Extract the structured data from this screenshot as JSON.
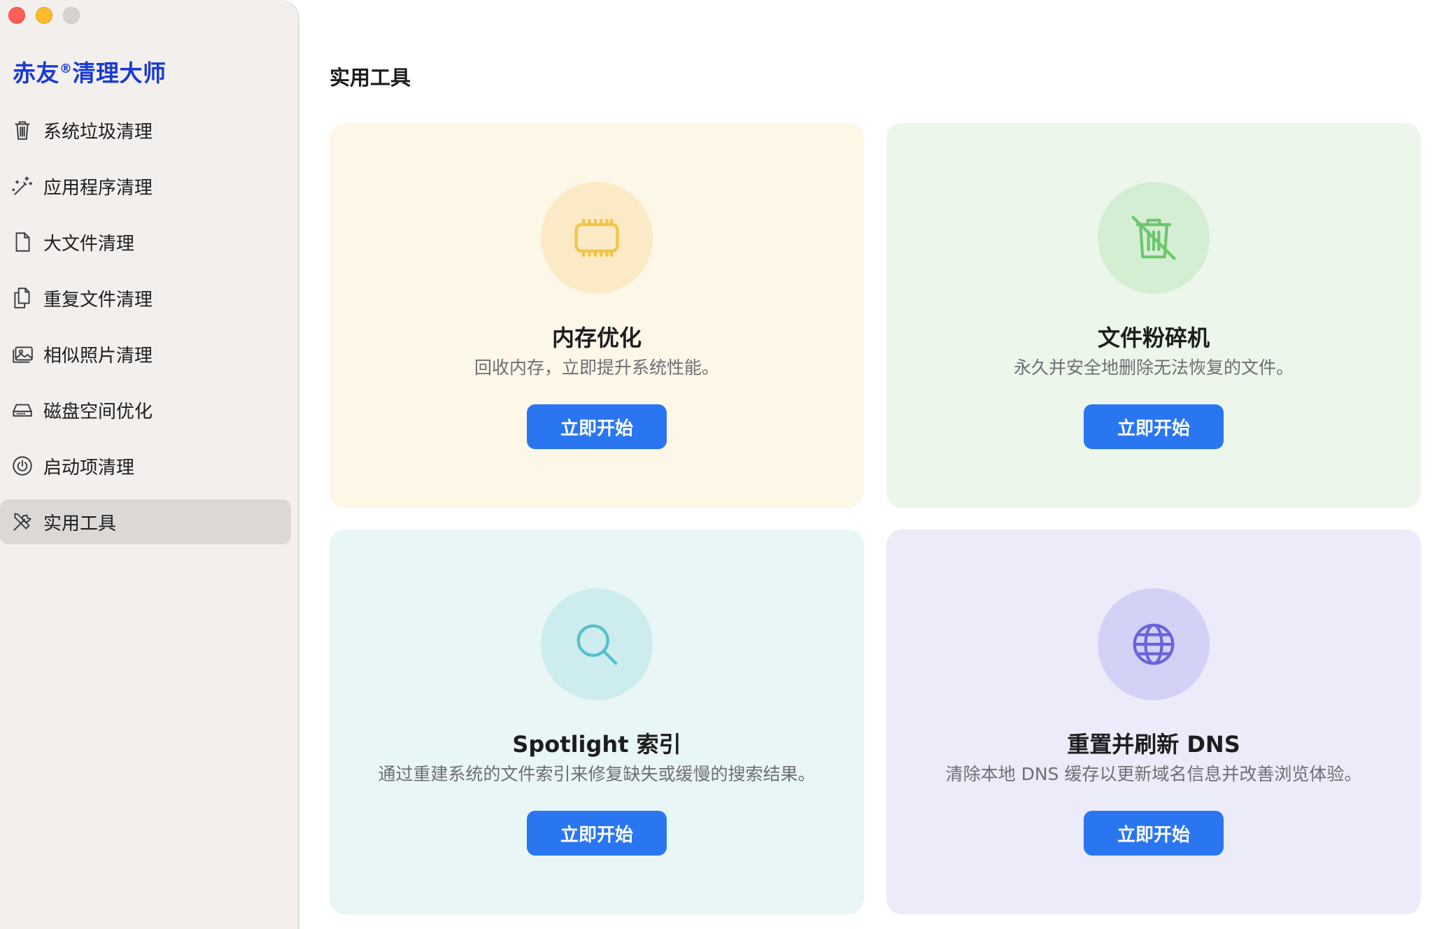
{
  "window": {
    "controls": [
      "close",
      "minimize",
      "zoom"
    ]
  },
  "sidebar": {
    "brand_prefix": "赤友",
    "brand_mark": "®",
    "brand_suffix": "清理大师",
    "items": [
      {
        "label": "系统垃圾清理",
        "icon": "trash-icon",
        "active": false
      },
      {
        "label": "应用程序清理",
        "icon": "magic-wand-icon",
        "active": false
      },
      {
        "label": "大文件清理",
        "icon": "document-icon",
        "active": false
      },
      {
        "label": "重复文件清理",
        "icon": "duplicate-documents-icon",
        "active": false
      },
      {
        "label": "相似照片清理",
        "icon": "photos-icon",
        "active": false
      },
      {
        "label": "磁盘空间优化",
        "icon": "disk-drive-icon",
        "active": false
      },
      {
        "label": "启动项清理",
        "icon": "power-icon",
        "active": false
      },
      {
        "label": "实用工具",
        "icon": "tools-icon",
        "active": true
      }
    ]
  },
  "main": {
    "title": "实用工具",
    "cards": [
      {
        "title": "内存优化",
        "description": "回收内存，立即提升系统性能。",
        "button": "立即开始",
        "icon": "memory-chip-icon",
        "accent": "#f3c44a"
      },
      {
        "title": "文件粉碎机",
        "description": "永久并安全地删除无法恢复的文件。",
        "button": "立即开始",
        "icon": "shredder-trash-icon",
        "accent": "#6dc66f"
      },
      {
        "title": "Spotlight 索引",
        "description": "通过重建系统的文件索引来修复缺失或缓慢的搜索结果。",
        "button": "立即开始",
        "icon": "magnifier-icon",
        "accent": "#55bfcc"
      },
      {
        "title": "重置并刷新 DNS",
        "description": "清除本地 DNS 缓存以更新域名信息并改善浏览体验。",
        "button": "立即开始",
        "icon": "globe-icon",
        "accent": "#6b62dc"
      }
    ],
    "button_color": "#2a76f0"
  }
}
